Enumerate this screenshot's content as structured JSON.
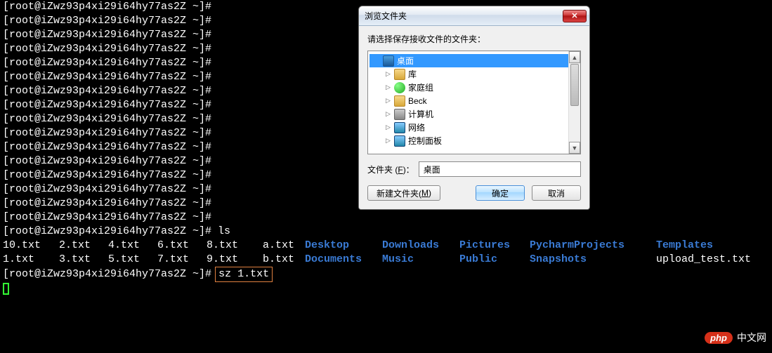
{
  "terminal": {
    "prompt": "[root@iZwz93p4xi29i64hy77as2Z ~]# ",
    "blank_lines": 16,
    "ls_cmd": "ls",
    "row1": {
      "c1": "10.txt",
      "c2": "2.txt",
      "c3": "4.txt",
      "c4": "6.txt",
      "c5": "8.txt",
      "c6": "a.txt",
      "c7": "Desktop",
      "c8": "Downloads",
      "c9": "Pictures",
      "c10": "PycharmProjects",
      "c11": "Templates"
    },
    "row2": {
      "c1": "1.txt",
      "c2": "3.txt",
      "c3": "5.txt",
      "c4": "7.txt",
      "c5": "9.txt",
      "c6": "b.txt",
      "c7": "Documents",
      "c8": "Music",
      "c9": "Public",
      "c10": "Snapshots",
      "c11": "upload_test.txt"
    },
    "current_cmd": "sz 1.txt"
  },
  "dialog": {
    "title": "浏览文件夹",
    "hint": "请选择保存接收文件的文件夹：",
    "tree": {
      "items": [
        {
          "label": "桌面",
          "icon": "ico-desktop",
          "selected": true,
          "expandable": false
        },
        {
          "label": "库",
          "icon": "ico-library",
          "selected": false,
          "expandable": true
        },
        {
          "label": "家庭组",
          "icon": "ico-homegroup",
          "selected": false,
          "expandable": true
        },
        {
          "label": "Beck",
          "icon": "ico-user",
          "selected": false,
          "expandable": true
        },
        {
          "label": "计算机",
          "icon": "ico-computer",
          "selected": false,
          "expandable": true
        },
        {
          "label": "网络",
          "icon": "ico-network",
          "selected": false,
          "expandable": true
        },
        {
          "label": "控制面板",
          "icon": "ico-ctrl",
          "selected": false,
          "expandable": true
        }
      ]
    },
    "path_label_pre": "文件夹 (",
    "path_label_key": "F",
    "path_label_post": ")：",
    "path_value": "桌面",
    "btn_new_pre": "新建文件夹(",
    "btn_new_key": "M",
    "btn_new_post": ")",
    "btn_ok": "确定",
    "btn_cancel": "取消"
  },
  "watermark": {
    "logo": "php",
    "text": "中文网"
  }
}
